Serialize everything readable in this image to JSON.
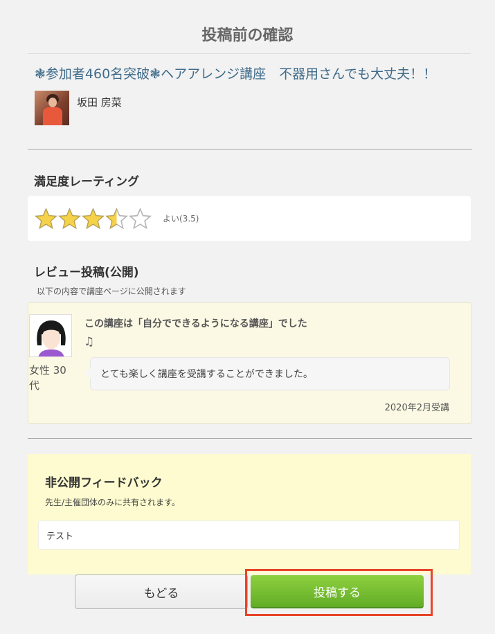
{
  "page": {
    "title": "投稿前の確認"
  },
  "course": {
    "title": "❃参加者460名突破❃ヘアアレンジ講座　不器用さんでも大丈夫！！",
    "teacher_name": "坂田 房菜"
  },
  "rating": {
    "heading": "満足度レーティング",
    "value": 3.5,
    "max": 5,
    "label": "よい(3.5)",
    "star_color": "#f5d24a"
  },
  "review": {
    "heading": "レビュー投稿(公開)",
    "subtitle": "以下の内容で講座ページに公開されます",
    "reviewer": "女性 30代",
    "headline": "この講座は「自分でできるようになる講座」でした",
    "note_icon": "♫",
    "body": "とても楽しく講座を受講することができました。",
    "date": "2020年2月受講"
  },
  "feedback": {
    "heading": "非公開フィードバック",
    "subtitle": "先生/主催団体のみに共有されます。",
    "value": "テスト"
  },
  "buttons": {
    "back_label": "もどる",
    "submit_label": "投稿する"
  },
  "colors": {
    "accent": "#62ac26",
    "highlight_frame": "#e8442a",
    "title_blue": "#3f6b8a"
  }
}
